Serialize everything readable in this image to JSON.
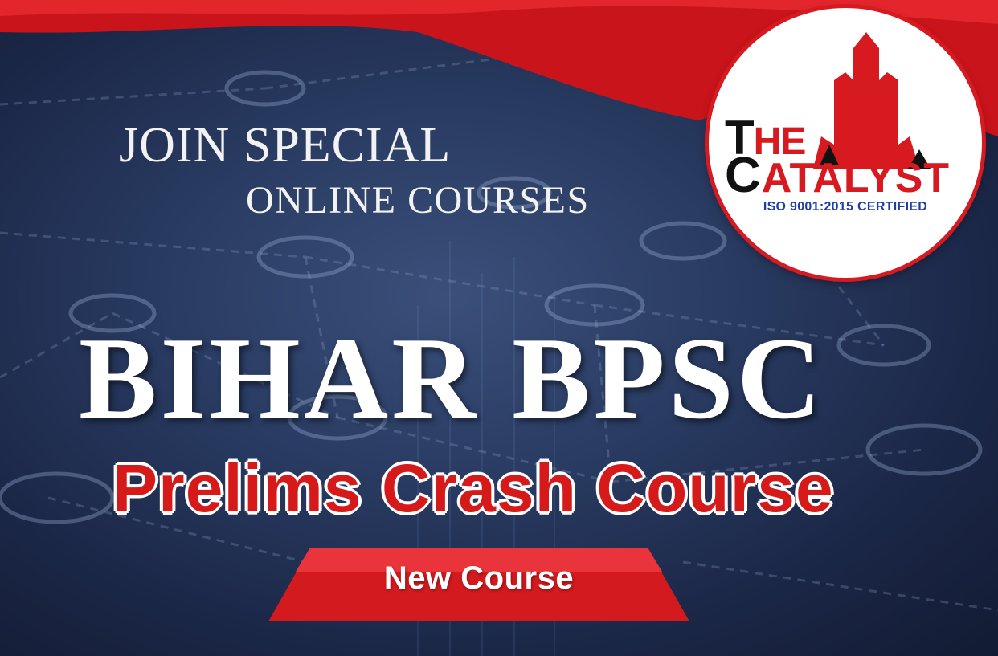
{
  "banner": {
    "heading_line1": "JOIN SPECIAL",
    "heading_line2": "ONLINE COURSES",
    "main_title": "BIHAR BPSC",
    "subtitle": "Prelims Crash Course",
    "cta_label": "New Course"
  },
  "logo": {
    "line1_initial": "T",
    "line1_rest": "HE",
    "line2_initial": "C",
    "line2_rest": "ATALYST",
    "certification": "ISO 9001:2015 CERTIFIED"
  },
  "colors": {
    "brand_red": "#d71920",
    "background_navy": "#1f2d4e",
    "text_white": "#ffffff",
    "cert_blue": "#1f3fa8"
  }
}
